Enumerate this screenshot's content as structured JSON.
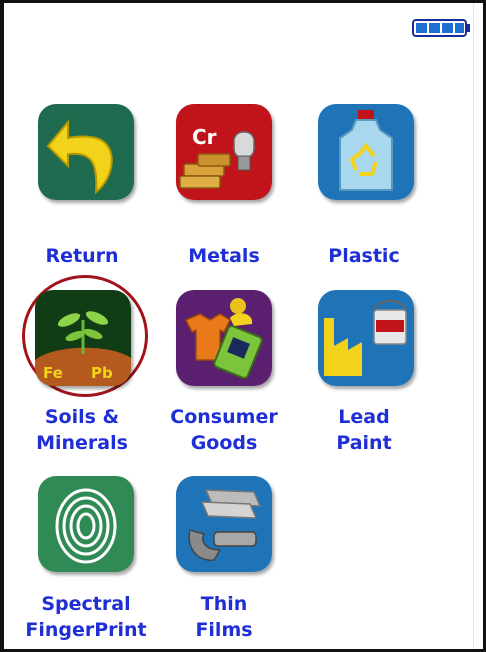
{
  "status": {
    "battery_icon": "battery-full-icon",
    "battery_level": 1.0
  },
  "menu": {
    "items": [
      {
        "id": "return",
        "label": "Return",
        "icon": "return-arrow-icon",
        "selected": false
      },
      {
        "id": "metals",
        "label": "Metals",
        "icon": "metals-icon",
        "icon_text": "Cr",
        "selected": false
      },
      {
        "id": "plastic",
        "label": "Plastic",
        "icon": "plastic-recycle-icon",
        "selected": false
      },
      {
        "id": "soils",
        "label": "Soils &\nMinerals",
        "icon": "soil-plant-icon",
        "icon_text_1": "Fe",
        "icon_text_2": "Pb",
        "selected": true
      },
      {
        "id": "consumer",
        "label": "Consumer\nGoods",
        "icon": "consumer-goods-icon",
        "selected": false
      },
      {
        "id": "leadpaint",
        "label": "Lead\nPaint",
        "icon": "lead-paint-icon",
        "selected": false
      },
      {
        "id": "spectral",
        "label": "Spectral\nFingerPrint",
        "icon": "fingerprint-icon",
        "selected": false
      },
      {
        "id": "thinfilms",
        "label": "Thin\nFilms",
        "icon": "thin-films-icon",
        "selected": false
      }
    ]
  },
  "colors": {
    "label": "#1f2fd6",
    "selection_ring": "#a0141a"
  }
}
